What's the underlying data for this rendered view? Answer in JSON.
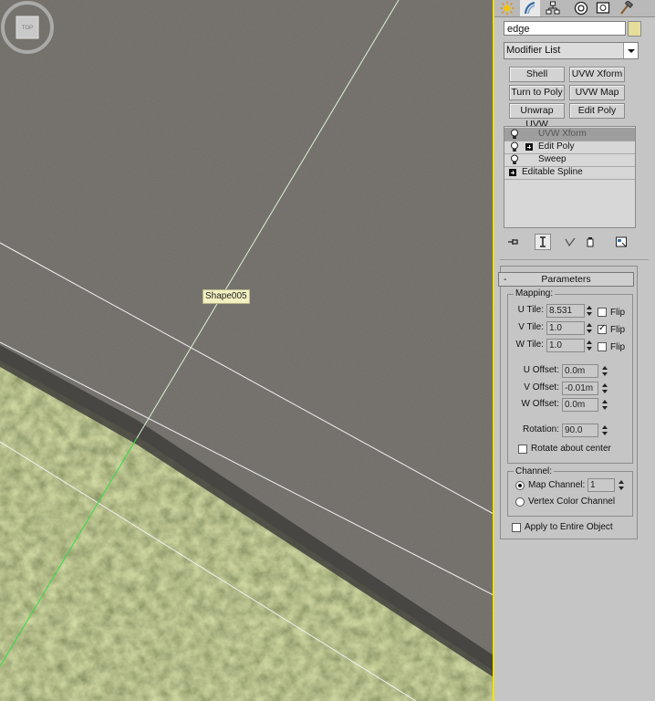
{
  "viewport": {
    "object_label": "Shape005",
    "viewcube_label": "TOP"
  },
  "panel": {
    "object_name": "edge",
    "object_color": "#e6dd9b",
    "modifier_list": "Modifier List",
    "modifier_buttons": [
      "Shell",
      "UVW Xform",
      "Turn to Poly",
      "UVW Map",
      "Unwrap UVW",
      "Edit Poly"
    ],
    "stack": [
      "UVW Xform",
      "Edit Poly",
      "Sweep",
      "Editable Spline"
    ],
    "parameters": {
      "title": "Parameters",
      "collapse": "-",
      "mapping_title": "Mapping:",
      "u_tile_label": "U Tile:",
      "u_tile": "8.531",
      "v_tile_label": "V Tile:",
      "v_tile": "1.0",
      "w_tile_label": "W Tile:",
      "w_tile": "1.0",
      "flip_label": "Flip",
      "u_flip": false,
      "v_flip": true,
      "w_flip": false,
      "u_offset_label": "U Offset:",
      "u_offset": "0.0m",
      "v_offset_label": "V Offset:",
      "v_offset": "-0.01m",
      "w_offset_label": "W Offset:",
      "w_offset": "0.0m",
      "rotation_label": "Rotation:",
      "rotation": "90.0",
      "rotate_center_label": "Rotate about center",
      "channel_title": "Channel:",
      "map_channel_label": "Map Channel:",
      "map_channel": "1",
      "vertex_color_label": "Vertex Color Channel",
      "apply_entire_label": "Apply to Entire Object"
    }
  },
  "colors": {
    "active_viewport_border": "#f0e000",
    "selection_highlight": "#9e9e9e",
    "panel_bg": "#c5c5c5"
  }
}
